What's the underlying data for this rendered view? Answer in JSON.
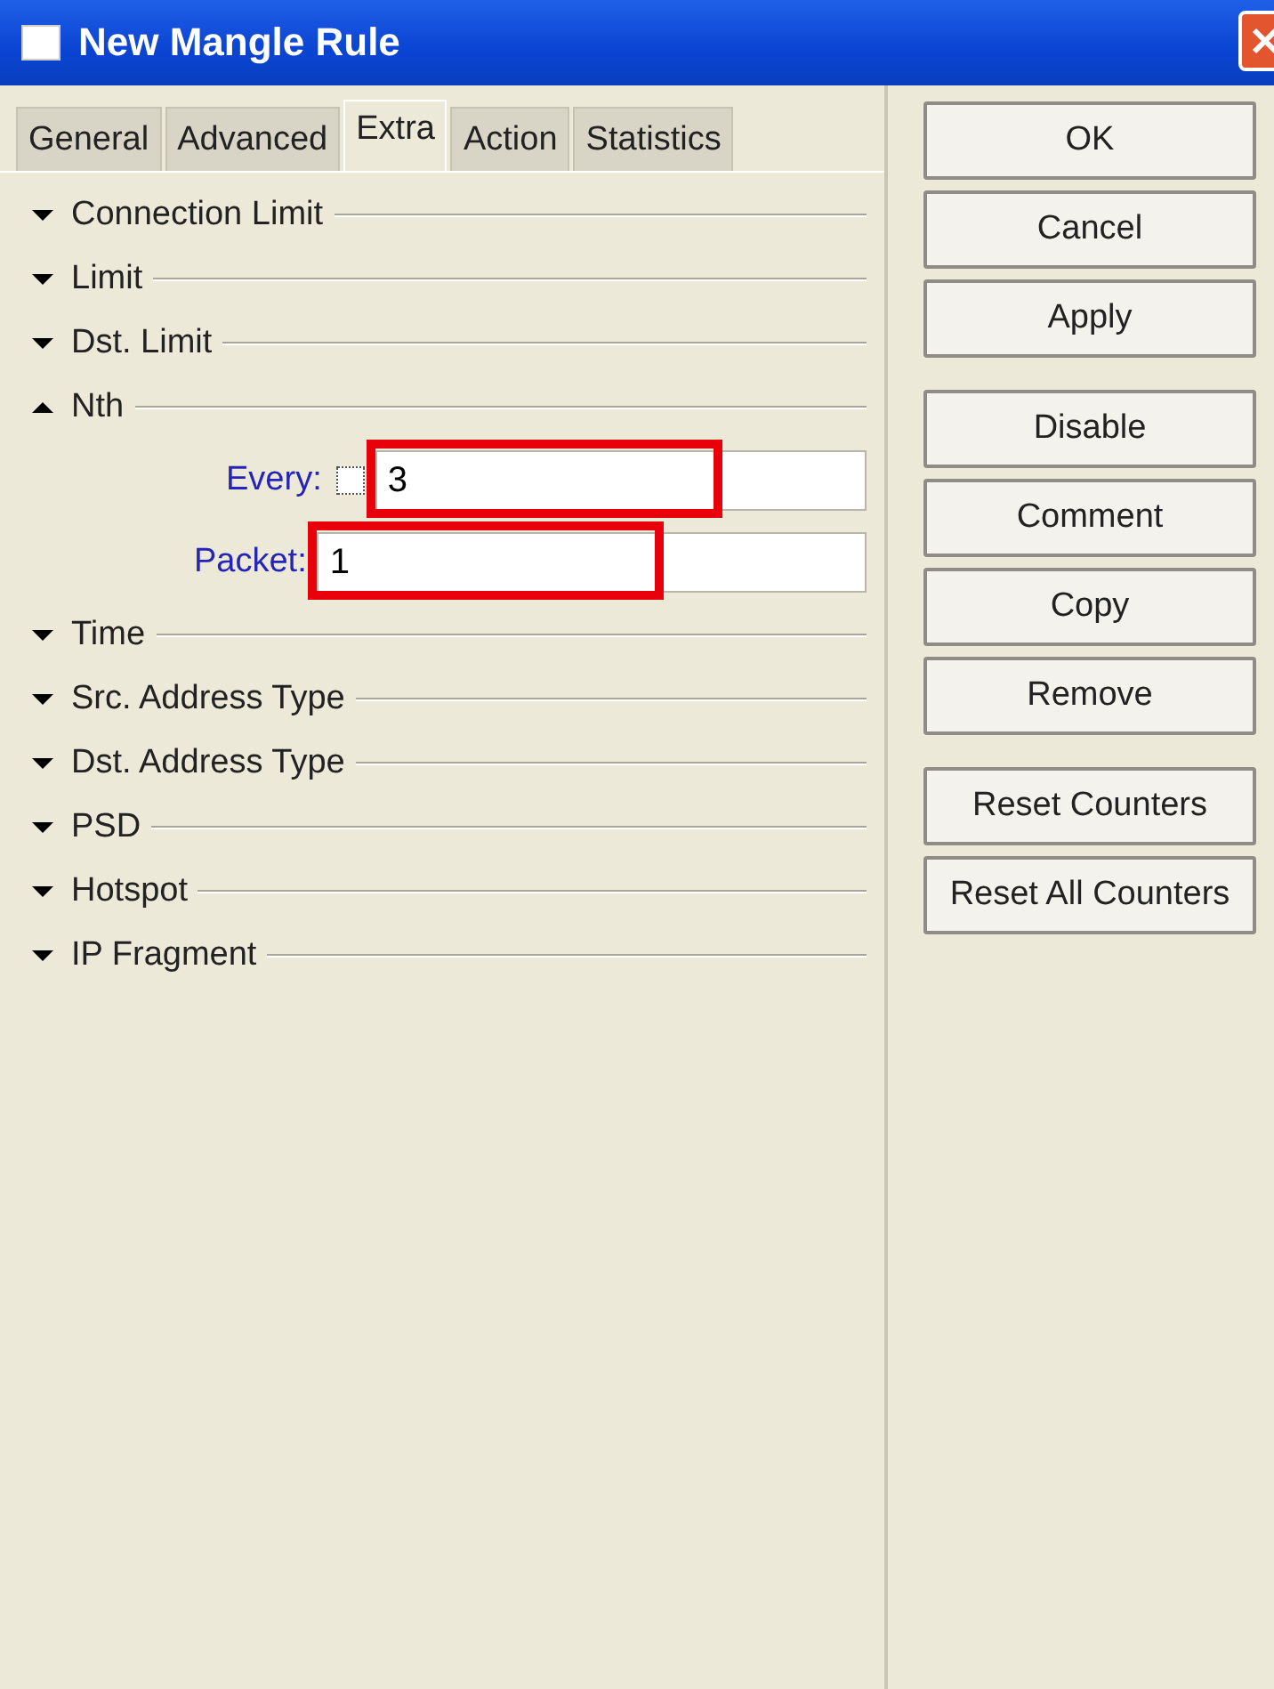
{
  "window": {
    "title": "New Mangle Rule"
  },
  "tabs": [
    {
      "label": "General",
      "selected": false
    },
    {
      "label": "Advanced",
      "selected": false
    },
    {
      "label": "Extra",
      "selected": true
    },
    {
      "label": "Action",
      "selected": false
    },
    {
      "label": "Statistics",
      "selected": false
    }
  ],
  "sections": [
    {
      "label": "Connection Limit",
      "expanded": false
    },
    {
      "label": "Limit",
      "expanded": false
    },
    {
      "label": "Dst. Limit",
      "expanded": false
    },
    {
      "label": "Nth",
      "expanded": true,
      "fields": [
        {
          "label": "Every:",
          "value": "3",
          "checked": false,
          "highlighted": true
        },
        {
          "label": "Packet:",
          "value": "1",
          "highlighted": true
        }
      ]
    },
    {
      "label": "Time",
      "expanded": false
    },
    {
      "label": "Src. Address Type",
      "expanded": false
    },
    {
      "label": "Dst. Address Type",
      "expanded": false
    },
    {
      "label": "PSD",
      "expanded": false
    },
    {
      "label": "Hotspot",
      "expanded": false
    },
    {
      "label": "IP Fragment",
      "expanded": false
    }
  ],
  "button_groups": [
    [
      "OK",
      "Cancel",
      "Apply"
    ],
    [
      "Disable",
      "Comment",
      "Copy",
      "Remove"
    ],
    [
      "Reset Counters",
      "Reset All Counters"
    ]
  ]
}
